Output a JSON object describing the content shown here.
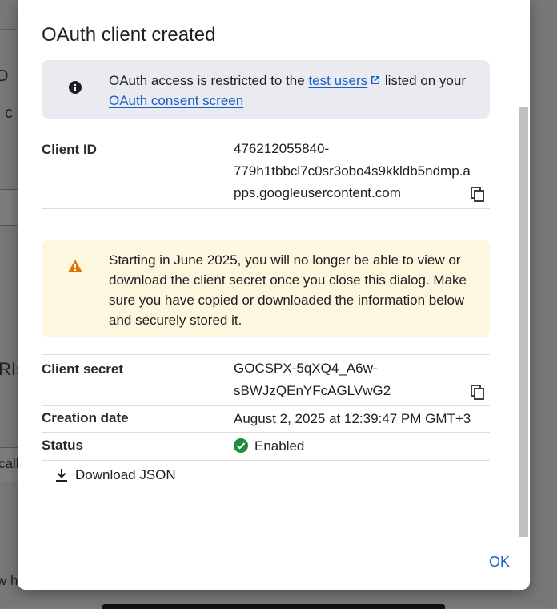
{
  "dialog": {
    "title": "OAuth client created",
    "info": {
      "text_before": "OAuth access is restricted to the ",
      "link_test_users": "test users",
      "text_mid": " listed on your ",
      "link_consent": "OAuth consent screen"
    },
    "client_id": {
      "label": "Client ID",
      "value_line1": "476212055840-",
      "value_line2": "779h1tbbcl7c0sr3obo4s9kkldb5ndmp.a",
      "value_line3": "pps.googleusercontent.com"
    },
    "warning": {
      "text": "Starting in June 2025, you will no longer be able to view or download the client secret once you close this dialog. Make sure you have copied or downloaded the information below and securely stored it."
    },
    "client_secret": {
      "label": "Client secret",
      "value_line1": "GOCSPX-5qXQ4_A6w-",
      "value_line2": "sBWJzQEnYFcAGLVwG2"
    },
    "creation_date": {
      "label": "Creation date",
      "value": "August 2, 2025 at 12:39:47 PM GMT+3"
    },
    "status": {
      "label": "Status",
      "value": "Enabled"
    },
    "download_label": "Download JSON",
    "ok_label": "OK"
  },
  "background": {
    "fragments": [
      "D",
      "c",
      "RIs",
      "call",
      "w h"
    ]
  },
  "colors": {
    "link": "#1a5fc7",
    "info_bg": "#e9ebf0",
    "warning_bg": "#fef7e0",
    "warning_icon": "#e37400",
    "status_ok": "#1e8e3e"
  }
}
